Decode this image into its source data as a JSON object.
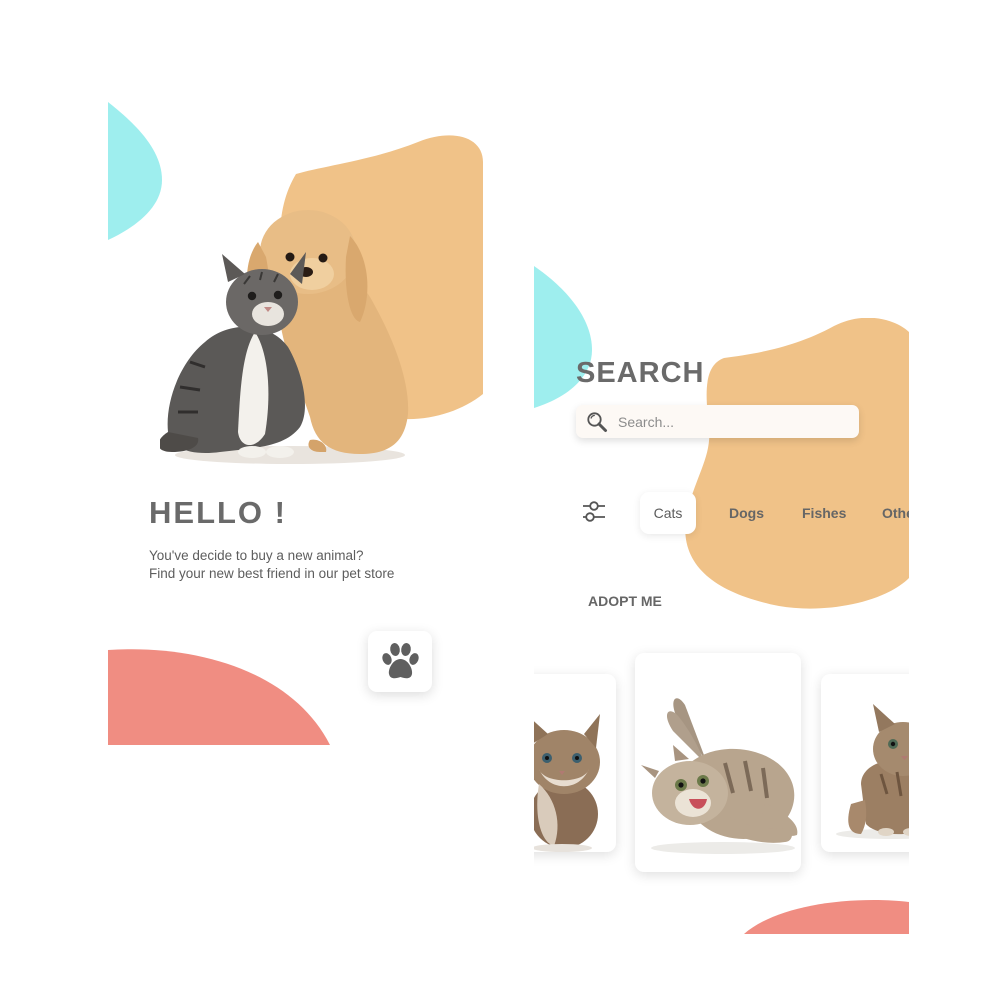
{
  "colors": {
    "peach": "#f0c288",
    "aqua": "#9eeeee",
    "coral": "#f08d82",
    "heading": "#6a6a6a",
    "text": "#5d5d5d"
  },
  "welcome": {
    "title": "HELLO !",
    "line1": "You've decide to buy a new animal?",
    "line2": "Find your new best friend in our pet store",
    "hero_image": "kitten-and-puppy-photo",
    "button_icon": "paw-icon"
  },
  "search": {
    "title": "SEARCH",
    "placeholder": "Search...",
    "search_icon": "search-icon",
    "filter_icon": "sliders-icon",
    "tabs": [
      {
        "label": "Cats",
        "active": true
      },
      {
        "label": "Dogs",
        "active": false
      },
      {
        "label": "Fishes",
        "active": false
      },
      {
        "label": "Others",
        "active": false
      }
    ],
    "section_title": "ADOPT ME",
    "cards": [
      {
        "image": "fluffy-kitten-photo"
      },
      {
        "image": "tabby-cat-lying-photo"
      },
      {
        "image": "kitten-walking-photo"
      }
    ]
  }
}
